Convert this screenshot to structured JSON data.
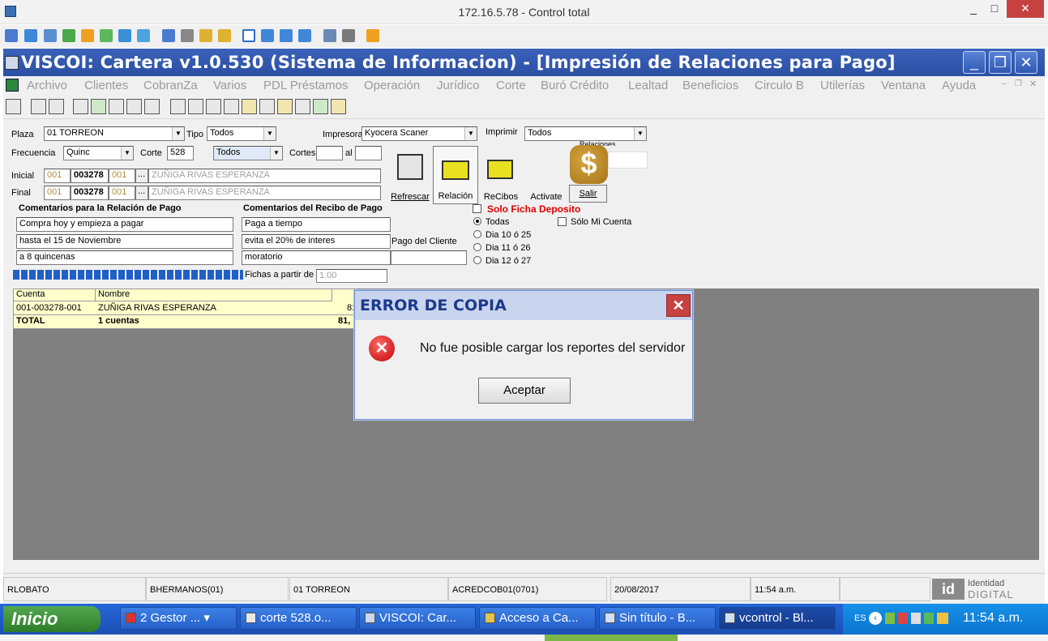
{
  "rdp": {
    "title": "172.16.5.78 - Control total",
    "minimize": "_",
    "maximize": "□",
    "close": "✕"
  },
  "app": {
    "title": "VISCOI: Cartera v1.0.530 (Sistema de Informacion) - [Impresión de Relaciones para Pago]"
  },
  "menu": [
    "Archivo",
    "Clientes",
    "CobranZa",
    "Varios",
    "PDL Préstamos",
    "Operación",
    "Jurídico",
    "Corte",
    "Buró Crédito",
    "Lealtad",
    "Beneficios",
    "Circulo B",
    "Utilerías",
    "Ventana",
    "Ayuda"
  ],
  "form": {
    "plaza_label": "Plaza",
    "plaza_value": "01 TORREON",
    "tipo_label": "Tipo",
    "tipo_value": "Todos",
    "impresora_label": "Impresora",
    "impresora_value": "Kyocera Scaner",
    "imprimir_label": "Imprimir",
    "imprimir_value": "Todos",
    "relaciones_label": "Relaciones",
    "frecuencia_label": "Frecuencia",
    "frecuencia_value": "Quinc",
    "corte_label": "Corte",
    "corte_value": "528",
    "todos2_value": "Todos",
    "cortes_label": "Cortes",
    "al_label": "al",
    "inicial_label": "Inicial",
    "final_label": "Final",
    "inicial": {
      "a": "001",
      "b": "003278",
      "c": "001",
      "name": "ZUÑIGA RIVAS ESPERANZA"
    },
    "final": {
      "a": "001",
      "b": "003278",
      "c": "001",
      "name": "ZUÑIGA RIVAS ESPERANZA"
    },
    "dots": "..."
  },
  "buttons": {
    "refrescar": "Refrescar",
    "relacion": "Relación",
    "recibos": "ReCibos",
    "activate": "Activate",
    "salir": "Salir"
  },
  "comentarios_relacion": {
    "title": "Comentarios para la Relación de Pago",
    "lines": [
      "Compra hoy y empieza a pagar",
      "hasta el 15 de Noviembre",
      "a 8 quincenas"
    ]
  },
  "comentarios_recibo": {
    "title": "Comentarios del Recibo de Pago",
    "lines": [
      "Paga a tiempo",
      "evita el 20% de interes",
      "moratorio"
    ],
    "pago_cliente": "Pago del Cliente"
  },
  "options": {
    "solo_ficha": "Solo Ficha Deposito",
    "todas": "Todas",
    "solo_mi_cuenta": "Sólo Mi Cuenta",
    "dia1": "Dia 10 ó 25",
    "dia2": "Dia 11 ó 26",
    "dia3": "Dia 12 ó 27",
    "fichas_label": "Fichas a partir de",
    "fichas_value": "1.00"
  },
  "grid": {
    "headers": [
      "Cuenta",
      "Nombre"
    ],
    "row": [
      "001-003278-001",
      "ZUÑIGA RIVAS ESPERANZA",
      "81"
    ],
    "total": [
      "TOTAL",
      "1 cuentas",
      "81,"
    ]
  },
  "dialog": {
    "title": "ERROR DE COPIA",
    "message": "No fue posible cargar los reportes del servidor",
    "ok": "Aceptar",
    "close": "✕"
  },
  "status": [
    "RLOBATO",
    "BHERMANOS(01)",
    "01 TORREON",
    "ACREDCOB01(0701)",
    "20/08/2017",
    "11:54 a.m."
  ],
  "brand": {
    "line1": "Identidad",
    "line2": "DIGITAL"
  },
  "taskbar": {
    "start": "Inicio",
    "items": [
      "2 Gestor ...",
      "corte 528.o...",
      "VISCOI: Car...",
      "Acceso a Ca...",
      "Sin título - B...",
      "vcontrol - Bl..."
    ],
    "lang": "ES",
    "clock": "11:54 a.m."
  }
}
